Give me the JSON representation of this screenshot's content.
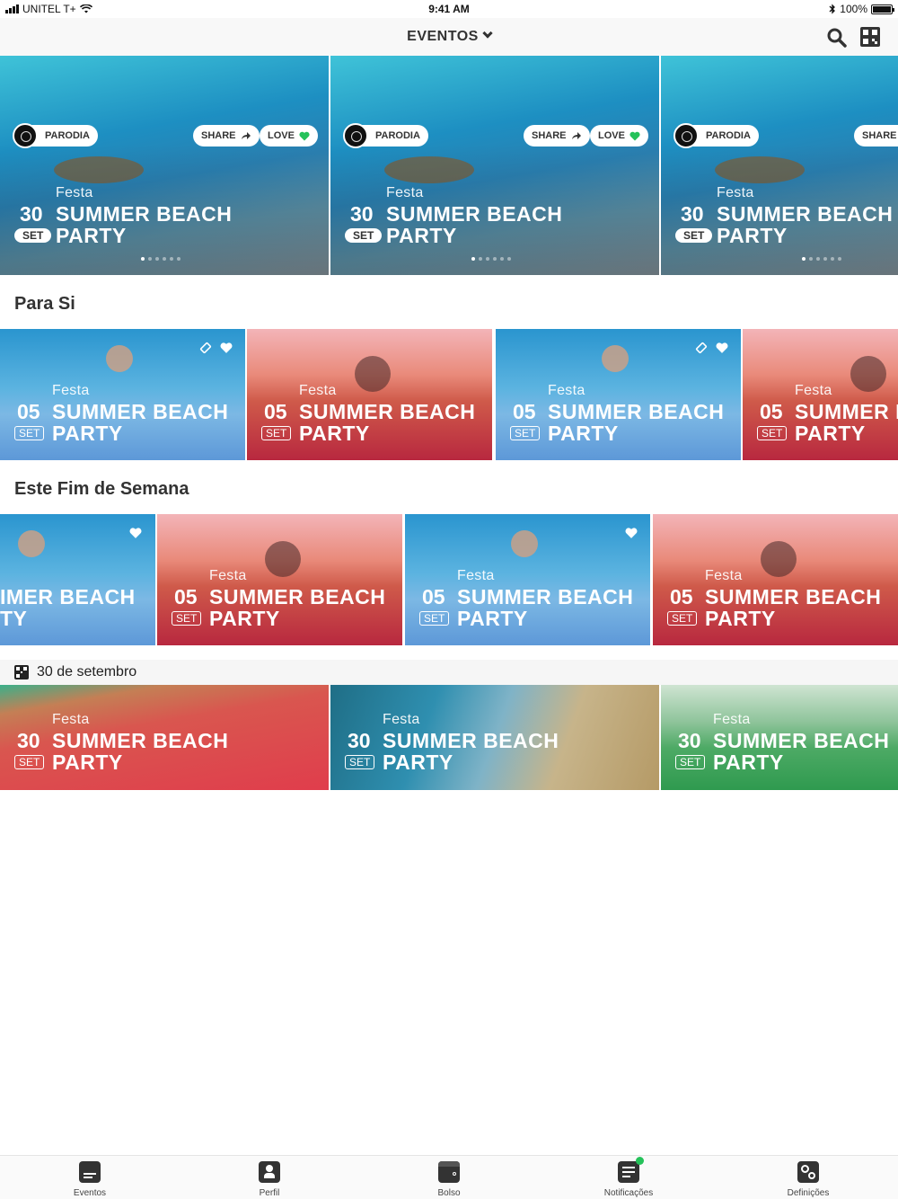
{
  "status_bar": {
    "carrier": "UNITEL T+",
    "time": "9:41 AM",
    "battery": "100%"
  },
  "nav": {
    "title": "EVENTOS"
  },
  "featured": {
    "items": [
      {
        "organizer": "PARODIA",
        "share": "SHARE",
        "love": "LOVE",
        "category": "Festa",
        "day": "30",
        "month": "SET",
        "title_line1": "SUMMER BEACH",
        "title_line2": "PARTY"
      },
      {
        "organizer": "PARODIA",
        "share": "SHARE",
        "love": "LOVE",
        "category": "Festa",
        "day": "30",
        "month": "SET",
        "title_line1": "SUMMER BEACH",
        "title_line2": "PARTY"
      },
      {
        "organizer": "PARODIA",
        "share": "SHARE",
        "category": "Festa",
        "day": "30",
        "month": "SET",
        "title_line1": "SUMMER BEACH",
        "title_line2": "PARTY"
      }
    ]
  },
  "section_para_si": {
    "title": "Para Si",
    "items": [
      {
        "category": "Festa",
        "day": "05",
        "month": "SET",
        "title_line1": "SUMMER BEACH",
        "title_line2": "PARTY"
      },
      {
        "category": "Festa",
        "day": "05",
        "month": "SET",
        "title_line1": "SUMMER BEACH",
        "title_line2": "PARTY"
      },
      {
        "category": "Festa",
        "day": "05",
        "month": "SET",
        "title_line1": "SUMMER BEACH",
        "title_line2": "PARTY"
      },
      {
        "category": "Festa",
        "day": "05",
        "month": "SET",
        "title_line1": "SUMMER B",
        "title_line2": "PARTY"
      }
    ]
  },
  "section_fim_semana": {
    "title": "Este Fim de Semana",
    "items": [
      {
        "title_line1": "IMER BEACH",
        "title_line2": "TY"
      },
      {
        "category": "Festa",
        "day": "05",
        "month": "SET",
        "title_line1": "SUMMER BEACH",
        "title_line2": "PARTY"
      },
      {
        "category": "Festa",
        "day": "05",
        "month": "SET",
        "title_line1": "SUMMER BEACH",
        "title_line2": "PARTY"
      },
      {
        "category": "Festa",
        "day": "05",
        "month": "SET",
        "title_line1": "SUMMER BEACH",
        "title_line2": "PARTY"
      }
    ]
  },
  "section_date": {
    "label": "30 de setembro",
    "items": [
      {
        "category": "Festa",
        "day": "30",
        "month": "SET",
        "title_line1": "SUMMER BEACH",
        "title_line2": "PARTY"
      },
      {
        "category": "Festa",
        "day": "30",
        "month": "SET",
        "title_line1": "SUMMER BEACH",
        "title_line2": "PARTY"
      },
      {
        "category": "Festa",
        "day": "30",
        "month": "SET",
        "title_line1": "SUMMER BEACH",
        "title_line2": "PARTY"
      }
    ]
  },
  "tabbar": {
    "items": [
      {
        "label": "Eventos",
        "icon": "events-icon"
      },
      {
        "label": "Perfil",
        "icon": "profile-icon"
      },
      {
        "label": "Bolso",
        "icon": "wallet-icon"
      },
      {
        "label": "Notificações",
        "icon": "notifications-icon"
      },
      {
        "label": "Definições",
        "icon": "settings-icon"
      }
    ]
  },
  "colors": {
    "love_heart": "#25c25a",
    "notification_dot": "#25c25a",
    "sea_blue": "#3a9fd0",
    "sunset_red": "#c8364e"
  }
}
